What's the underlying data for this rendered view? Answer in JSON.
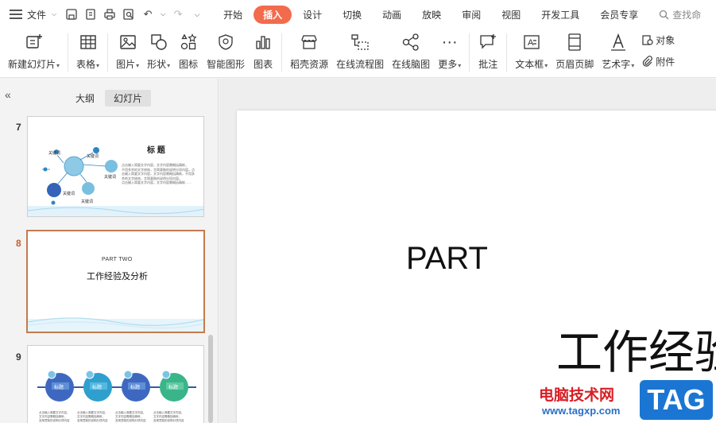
{
  "menubar": {
    "file_label": "文件",
    "tabs": [
      "开始",
      "插入",
      "设计",
      "切换",
      "动画",
      "放映",
      "审阅",
      "视图",
      "开发工具",
      "会员专享"
    ],
    "active_tab": "插入",
    "search_label": "查找命"
  },
  "ribbon": {
    "new_slide": "新建幻灯片",
    "table": "表格",
    "picture": "图片",
    "shape": "形状",
    "icon": "图标",
    "smart_graphic": "智能图形",
    "chart": "图表",
    "docer_resource": "稻壳资源",
    "online_flowchart": "在线流程图",
    "online_mindmap": "在线脑图",
    "more": "更多",
    "comment": "批注",
    "textbox": "文本框",
    "header_footer": "页眉页脚",
    "wordart": "艺术字",
    "object": "对象",
    "attachment": "附件"
  },
  "panel": {
    "tab_outline": "大纲",
    "tab_slides": "幻灯片"
  },
  "slides": [
    {
      "number": "7",
      "title": "标 题",
      "keyword": "关键词",
      "body_lines": [
        "点击输入简要文字内容，文字内容需概括精练，",
        "不用多余的文字修饰，言简意赅的说明分项内容。点",
        "击输入简要文字内容，文字内容需概括精练，不用多",
        "余的文字修饰，言简意赅的说明分项内容。",
        "点击输入简要文字内容，文字内容需概括精练……"
      ]
    },
    {
      "number": "8",
      "part": "PART TWO",
      "title": "工作经验及分析"
    },
    {
      "number": "9",
      "labels": [
        "标题",
        "标题",
        "标题",
        "标题"
      ],
      "text_lines": [
        "点击输入简要文字内容，",
        "文字内容需概括精练，",
        "言简意赅的说明分项内容"
      ]
    }
  ],
  "canvas": {
    "part_text": "PART",
    "title_text": "工作经验"
  },
  "watermark": {
    "site_name": "电脑技术网",
    "url": "www.tagxp.com",
    "tag": "TAG"
  }
}
